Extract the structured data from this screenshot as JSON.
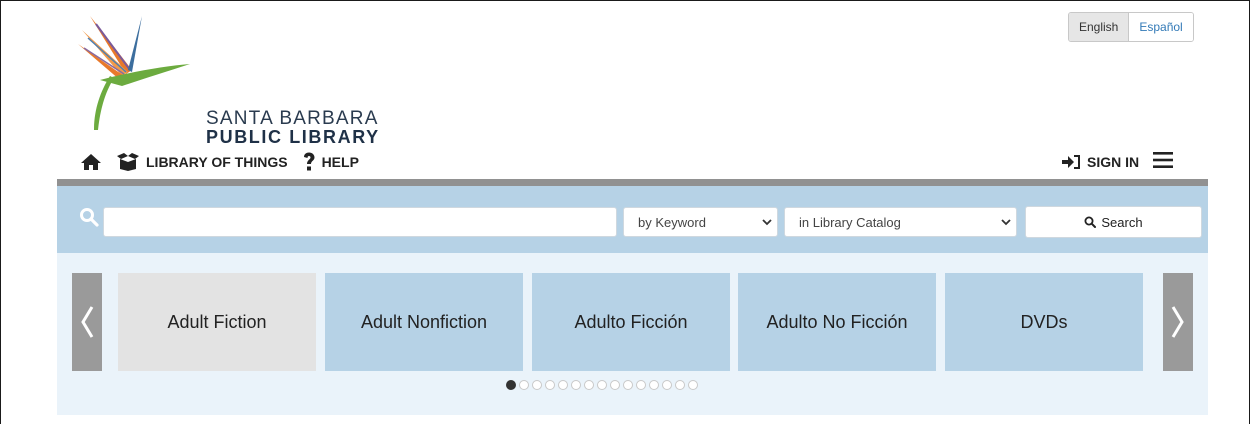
{
  "language": {
    "english": "English",
    "spanish": "Español"
  },
  "logo": {
    "line1": "SANTA BARBARA",
    "line2": "PUBLIC LIBRARY"
  },
  "nav": {
    "library_of_things": "LIBRARY OF THINGS",
    "help": "HELP",
    "sign_in": "SIGN IN"
  },
  "search": {
    "query": "",
    "search_by": "by Keyword",
    "search_in": "in Library Catalog",
    "button": "Search"
  },
  "carousel": {
    "items": [
      "Adult Fiction",
      "Adult Nonfiction",
      "Adulto Ficción",
      "Adulto No Ficción",
      "DVDs"
    ],
    "active_index": 0,
    "page_count": 15,
    "current_page": 1
  },
  "colors": {
    "band": "#b6d2e6",
    "active_card": "#e3e3e3",
    "logo_orange": "#e8792b",
    "logo_green": "#6cab3f"
  }
}
